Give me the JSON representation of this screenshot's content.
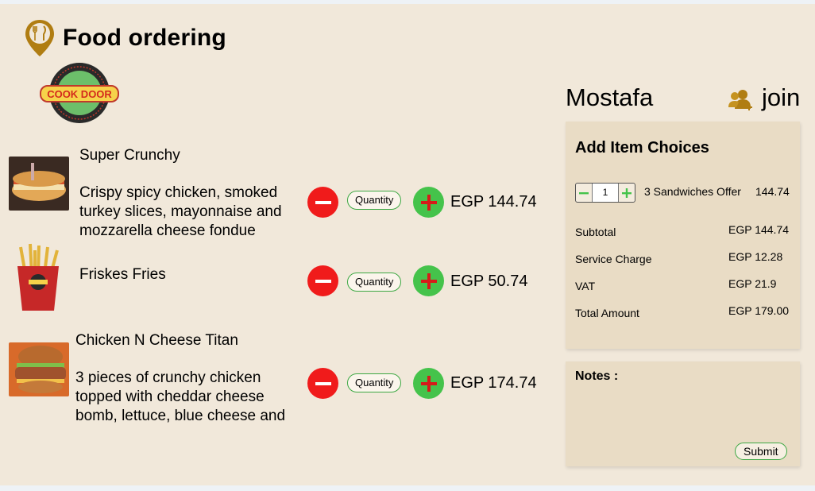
{
  "app": {
    "title": "Food ordering"
  },
  "brand": {
    "name": "COOK DOOR"
  },
  "items": [
    {
      "name": "Super Crunchy",
      "description": "Crispy spicy chicken, smoked turkey slices, mayonnaise and mozzarella cheese fondue",
      "quantity_label": "Quantity",
      "price": "EGP 144.74"
    },
    {
      "name": "Friskes Fries",
      "description": "",
      "quantity_label": "Quantity",
      "price": "EGP 50.74"
    },
    {
      "name": "Chicken N Cheese Titan",
      "description": "3 pieces of crunchy chicken topped with cheddar cheese bomb, lettuce, blue cheese and",
      "quantity_label": "Quantity",
      "price": "EGP 174.74"
    }
  ],
  "user": {
    "name": "Mostafa",
    "join_label": "join"
  },
  "choices": {
    "title": "Add Item Choices",
    "quantity": "1",
    "offer_name": "3 Sandwiches Offer",
    "offer_price": "144.74",
    "summary": [
      {
        "label": "Subtotal",
        "value": "EGP 144.74"
      },
      {
        "label": "Service Charge",
        "value": "EGP 12.28"
      },
      {
        "label": "VAT",
        "value": "EGP 21.9"
      },
      {
        "label": "Total Amount",
        "value": "EGP 179.00"
      }
    ]
  },
  "notes": {
    "label": "Notes :",
    "submit_label": "Submit"
  },
  "colors": {
    "background": "#f1e8da",
    "panel": "#e9dcc5",
    "minus": "#f01b1b",
    "plus": "#45c34b",
    "accent": "#b07d12"
  }
}
